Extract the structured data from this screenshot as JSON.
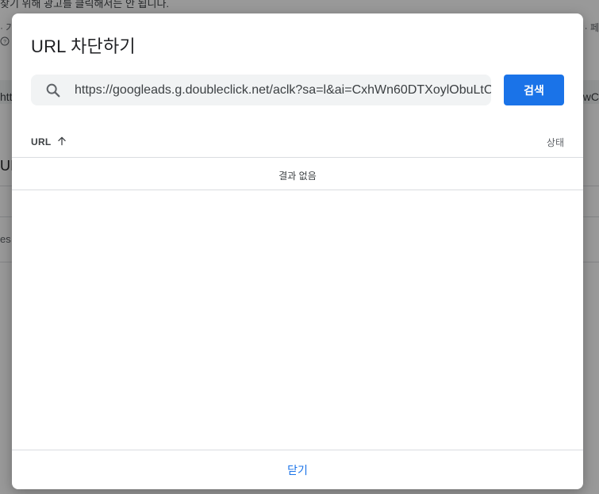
{
  "background": {
    "notice_text": "찾기 위해 광고를 클릭해서는 안 됩니다.",
    "line2_left": "· 가",
    "line2_right": "· 페",
    "help_icon": "help-circle-icon",
    "row_left": "htt",
    "row_right": "wC",
    "heading_fragment": "UI",
    "row_fragment": "es"
  },
  "dialog": {
    "title": "URL 차단하기",
    "search": {
      "icon": "search-icon",
      "value": "https://googleads.g.doubleclick.net/aclk?sa=l&ai=CxhWn60DTXoylObuLtC",
      "button_label": "검색"
    },
    "table": {
      "columns": [
        {
          "label": "URL",
          "sort": "ascending",
          "sort_icon": "arrow-up-icon"
        },
        {
          "label": "상태"
        }
      ],
      "empty_message": "결과 없음"
    },
    "footer": {
      "close_label": "닫기"
    }
  },
  "colors": {
    "accent": "#1a73e8",
    "scrim": "rgba(0,0,0,0.40)",
    "search_bg": "#f1f3f4",
    "divider": "#dadce0"
  }
}
